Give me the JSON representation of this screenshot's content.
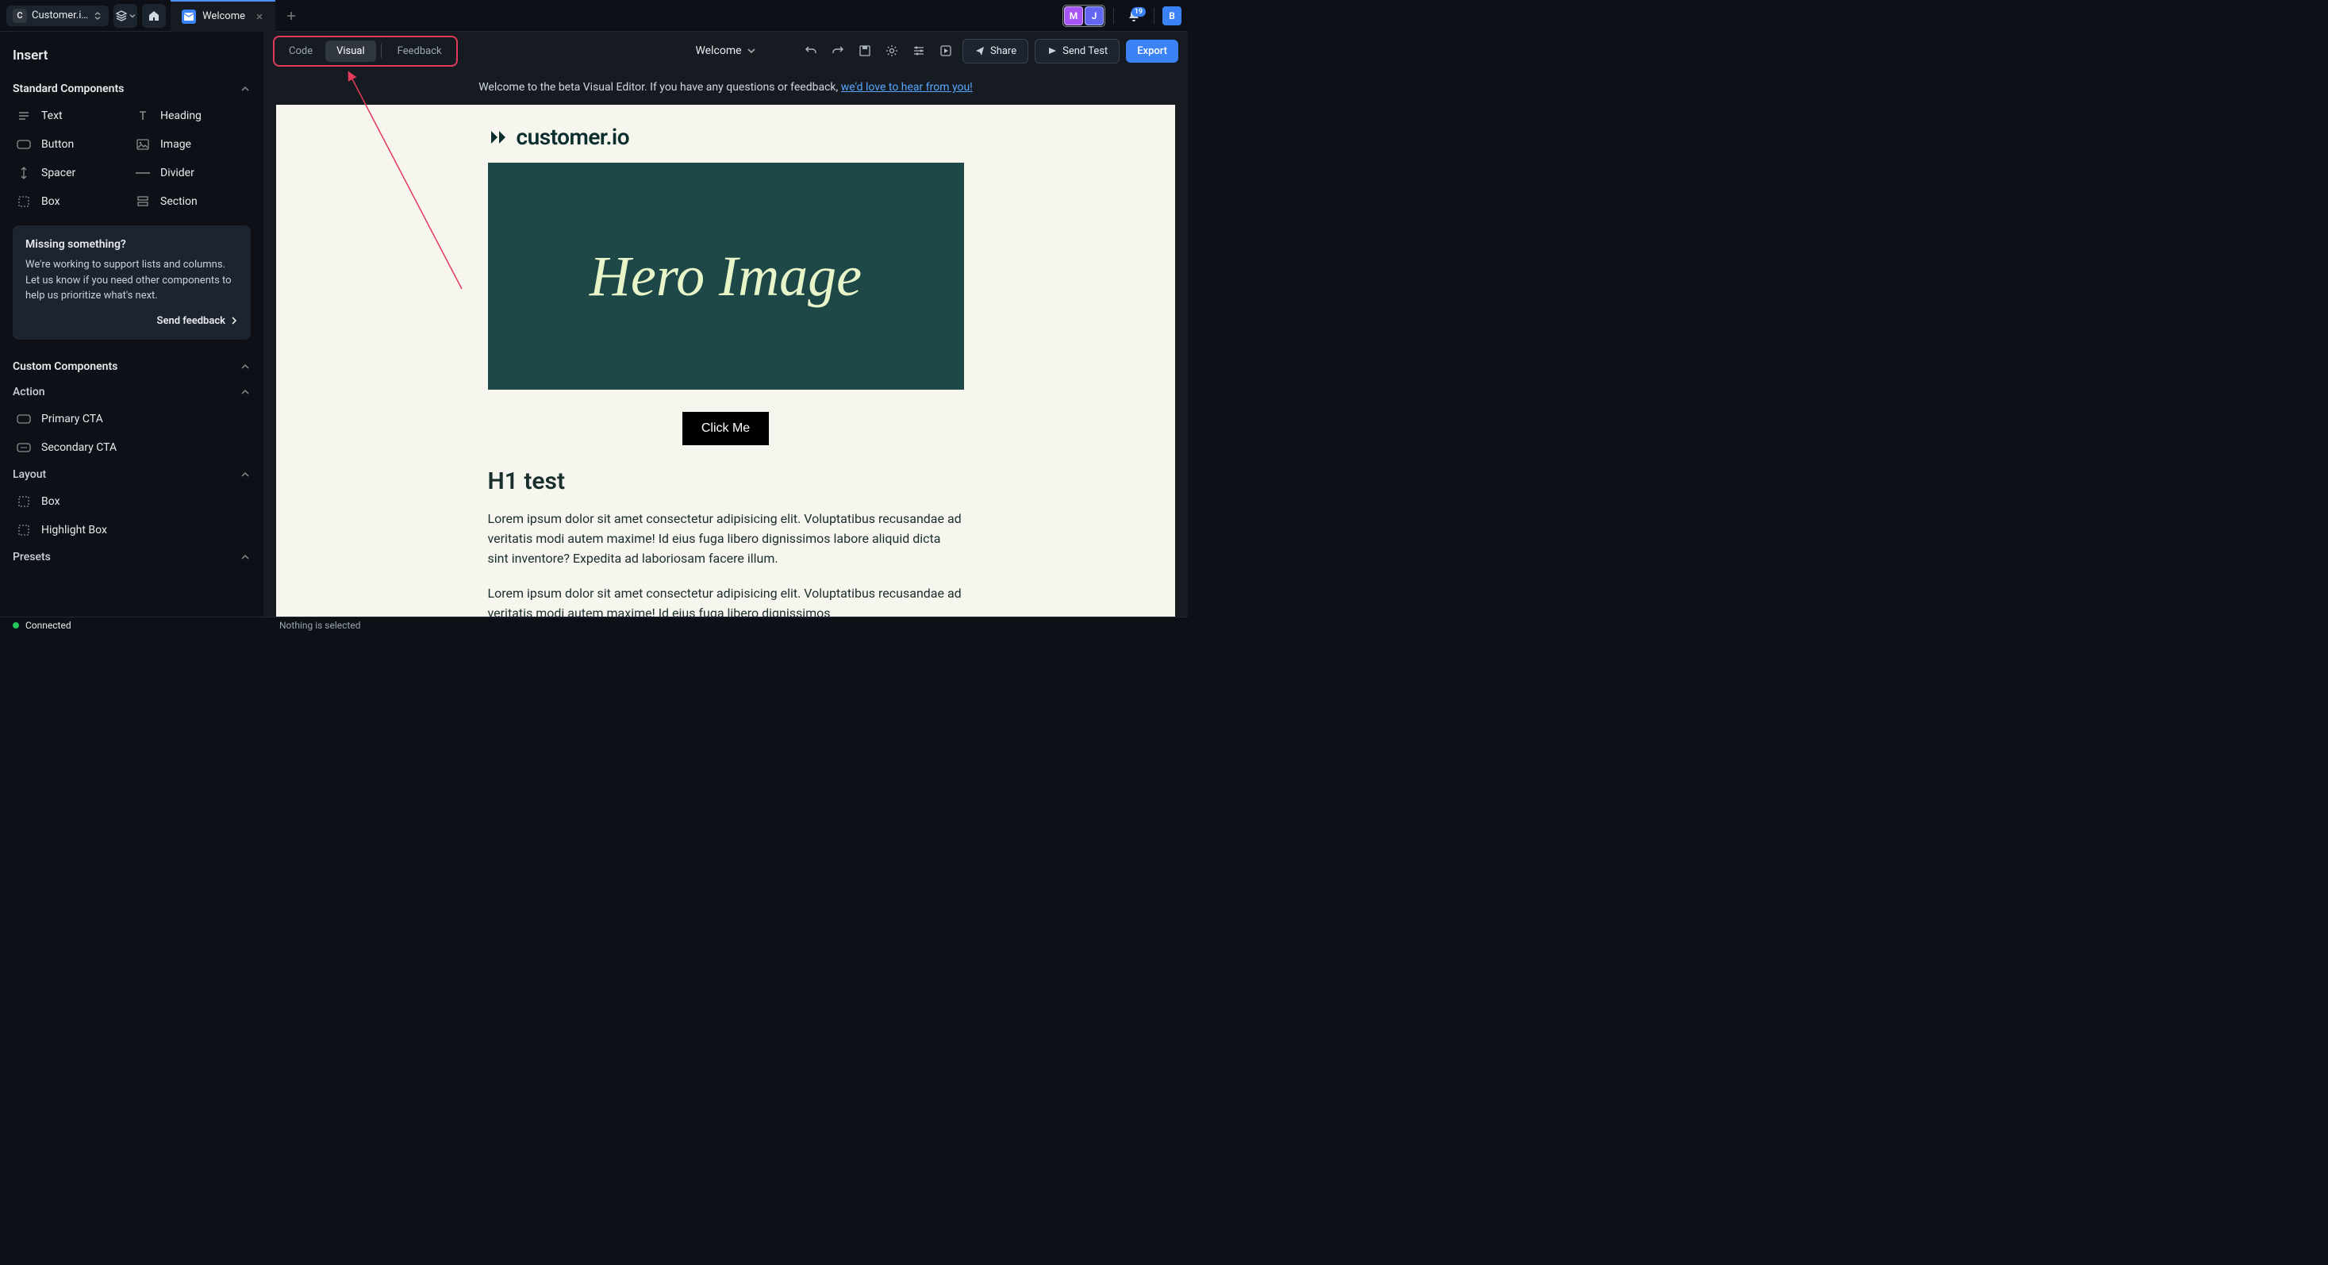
{
  "topbar": {
    "project_name": "Customer.i…",
    "project_initial": "C",
    "tab_label": "Welcome",
    "avatars": {
      "m": "M",
      "j": "J",
      "b": "B"
    },
    "notification_count": "19"
  },
  "sidebar": {
    "title": "Insert",
    "sections": {
      "standard": {
        "label": "Standard Components",
        "items": [
          {
            "label": "Text"
          },
          {
            "label": "Heading"
          },
          {
            "label": "Button"
          },
          {
            "label": "Image"
          },
          {
            "label": "Spacer"
          },
          {
            "label": "Divider"
          },
          {
            "label": "Box"
          },
          {
            "label": "Section"
          }
        ]
      },
      "missing": {
        "title": "Missing something?",
        "body": "We're working to support lists and columns. Let us know if you need other components to help us prioritize what's next.",
        "cta": "Send feedback"
      },
      "custom": {
        "label": "Custom Components"
      },
      "action": {
        "label": "Action",
        "items": [
          {
            "label": "Primary CTA"
          },
          {
            "label": "Secondary CTA"
          }
        ]
      },
      "layout": {
        "label": "Layout",
        "items": [
          {
            "label": "Box"
          },
          {
            "label": "Highlight Box"
          }
        ]
      },
      "presets": {
        "label": "Presets"
      }
    }
  },
  "editor": {
    "segments": {
      "code": "Code",
      "visual": "Visual",
      "feedback": "Feedback"
    },
    "doc_title": "Welcome",
    "actions": {
      "share": "Share",
      "send_test": "Send Test",
      "export": "Export"
    },
    "banner": {
      "text": "Welcome to the beta Visual Editor. If you have any questions or feedback, ",
      "link": "we'd love to hear from you!"
    }
  },
  "canvas": {
    "logo_text": "customer.io",
    "hero_text": "Hero Image",
    "cta_label": "Click Me",
    "h1": "H1 test",
    "p1": "Lorem ipsum dolor sit amet consectetur adipisicing elit. Voluptatibus recusandae ad veritatis modi autem maxime! Id eius fuga libero dignissimos labore aliquid dicta sint inventore? Expedita ad laboriosam facere illum.",
    "p2": "Lorem ipsum dolor sit amet consectetur adipisicing elit. Voluptatibus recusandae ad veritatis modi autem maxime! Id eius fuga libero dignissimos"
  },
  "status": {
    "connected": "Connected",
    "selection": "Nothing is selected"
  }
}
